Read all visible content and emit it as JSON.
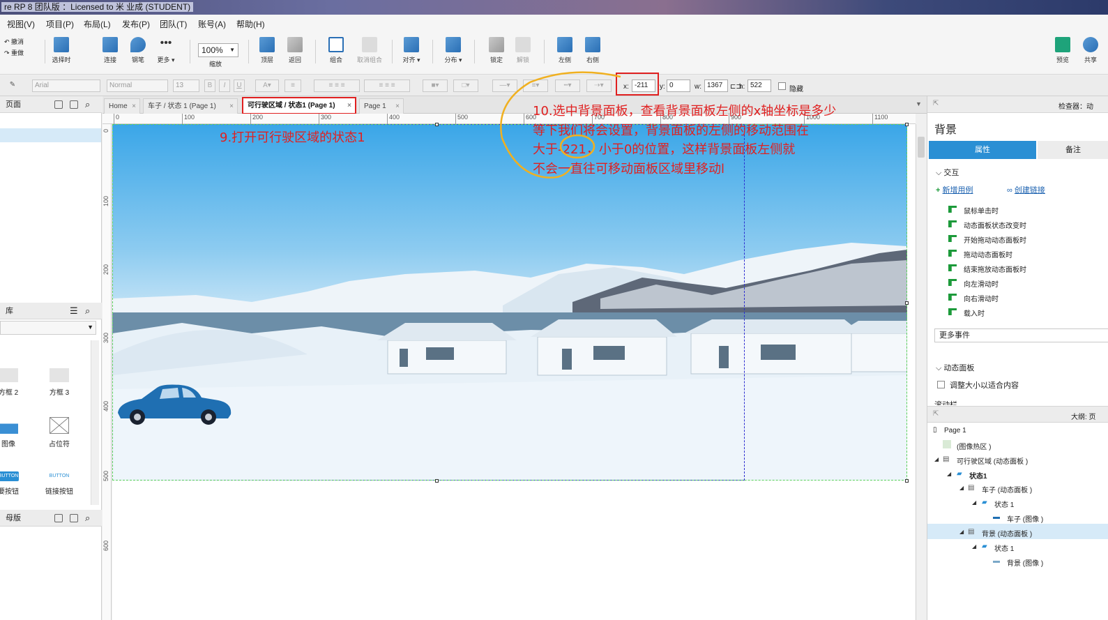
{
  "window": {
    "title": "re RP 8 团队版 ：Licensed to 米 业成 (STUDENT)"
  },
  "menu": [
    "视图(V)",
    "项目(P)",
    "布局(L)",
    "发布(P)",
    "团队(T)",
    "账号(A)",
    "帮助(H)"
  ],
  "toolbar": {
    "undo": "撤消",
    "redo": "重做",
    "select": "选择时",
    "connect": "连接",
    "pen": "钢笔",
    "more": "更多 ▾",
    "zoom_value": "100%",
    "zoom_label": "缩放",
    "top": "顶层",
    "back": "返回",
    "group": "组合",
    "ungroup": "取消组合",
    "align": "对齐 ▾",
    "distribute": "分布 ▾",
    "lock": "锁定",
    "unlock": "解锁",
    "left": "左侧",
    "right": "右侧",
    "preview": "预览",
    "share": "共享"
  },
  "format": {
    "font": "Arial",
    "style": "Normal",
    "size": "13",
    "x_label": "x:",
    "x": "-211",
    "y_label": "y:",
    "y": "0",
    "w_label": "w:",
    "w": "1367",
    "h_label": "h:",
    "h": "522",
    "hidden_label": "隐藏"
  },
  "left": {
    "pages_title": "页面",
    "library_title": "库",
    "masters_title": "母版",
    "library_items": [
      "方框 2",
      "方框 3",
      "图像",
      "占位符",
      "要按钮",
      "链接按钮"
    ],
    "button_text": "BUTTON"
  },
  "tabs": [
    {
      "label": "Home"
    },
    {
      "label": "车子 / 状态 1 (Page 1)"
    },
    {
      "label": "可行驶区域 / 状态1  (Page 1)"
    },
    {
      "label": "Page 1"
    }
  ],
  "ruler": {
    "h": [
      "0",
      "100",
      "200",
      "300",
      "400",
      "500",
      "600",
      "700",
      "800",
      "900",
      "1000",
      "1100"
    ],
    "v": [
      "0",
      "100",
      "200",
      "300",
      "400",
      "500",
      "600"
    ]
  },
  "annotations": {
    "step9": "9.打开可行驶区域的状态1",
    "step10_lines": [
      "10.选中背景面板，查看背景面板左侧的x轴坐标是多少",
      "等下我们将会设置，背景面板的左侧的移动范围在",
      "大于-221，小于0的位置，这样背景面板左侧就",
      "不会一直往可移动面板区域里移动l"
    ]
  },
  "inspector": {
    "header": "检查器：动",
    "name": "背景",
    "tab_props": "属性",
    "tab_notes": "备注",
    "interaction": "交互",
    "new_case": "新增用例",
    "create_link": "创建链接",
    "events": [
      "鼠标单击时",
      "动态面板状态改变时",
      "开始拖动动态面板时",
      "拖动动态面板时",
      "结束拖放动态面板时",
      "向左滑动时",
      "向右滑动时",
      "载入时"
    ],
    "more_events": "更多事件",
    "dynamic_panel": "动态面板",
    "fit_content": "调整大小以适合内容",
    "scroll_partial": "滚动栏"
  },
  "outline": {
    "header": "大纲: 页",
    "items": [
      {
        "label": "Page 1"
      },
      {
        "label": "(图像热区 )"
      },
      {
        "label": "可行驶区域 (动态面板 )"
      },
      {
        "label": "状态1"
      },
      {
        "label": "车子 (动态面板 )"
      },
      {
        "label": "状态 1"
      },
      {
        "label": "车子 (图像 )"
      },
      {
        "label": "背景 (动态面板 )"
      },
      {
        "label": "状态 1"
      },
      {
        "label": "背景 (图像 )"
      }
    ]
  },
  "colors": {
    "accent": "#2a8fd4",
    "annotation": "#e02020",
    "selection_row": "#d6eaf8"
  }
}
